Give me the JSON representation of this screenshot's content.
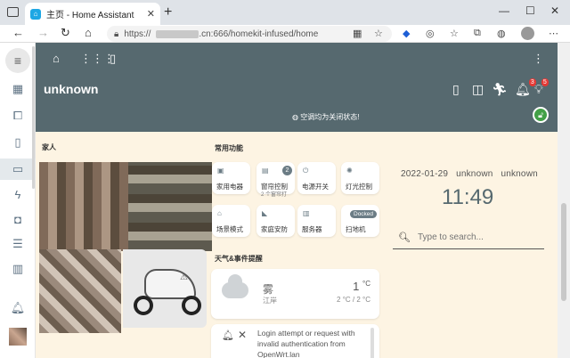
{
  "browser": {
    "tab_title": "主页 - Home Assistant",
    "tab_icon": "home-assistant-icon",
    "url_prefix": "https://",
    "url_domain": ".cn:666/homekit-infused/home"
  },
  "sidebar": {
    "items": [
      "dashboard-icon",
      "devices-icon",
      "tablet-icon",
      "monitor-icon",
      "energy-icon",
      "person-icon",
      "list-icon",
      "chart-icon",
      "notifications-icon"
    ]
  },
  "header": {
    "title": "unknown",
    "notice": "空调均为关闭状态!",
    "badge_1": "3",
    "badge_2": "5"
  },
  "sections": {
    "family": "家人",
    "common": "常用功能",
    "weather_alert": "天气&事件提醒"
  },
  "functions": [
    {
      "label": "家用电器",
      "sub": ""
    },
    {
      "label": "窗帘控制",
      "sub": "2 个窗帘打",
      "count": "2"
    },
    {
      "label": "电源开关",
      "sub": ""
    },
    {
      "label": "灯光控制",
      "sub": ""
    },
    {
      "label": "场景模式",
      "sub": ""
    },
    {
      "label": "家庭安防",
      "sub": ""
    },
    {
      "label": "服务器",
      "sub": ""
    },
    {
      "label": "扫地机",
      "sub": "",
      "chip": "Docked"
    }
  ],
  "weather": {
    "condition": "雾",
    "location": "江岸",
    "temp": "1",
    "unit": "°C",
    "range": "2 °C / 2 °C"
  },
  "notification": {
    "message": "Login attempt or request with invalid authentication from OpenWrt.lan"
  },
  "right": {
    "datetime": "2022-01-29   unknown   unknown",
    "time": "11:49",
    "search_placeholder": "Type to search..."
  },
  "colors": {
    "header": "#56696f",
    "background": "#fdf4e3",
    "accent": "#43a047"
  }
}
